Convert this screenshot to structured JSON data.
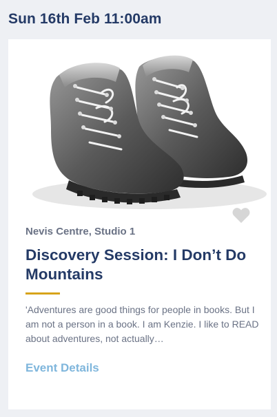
{
  "event": {
    "date": "Sun 16th Feb 11:00am",
    "image_alt": "Sketch of a pair of hiking boots",
    "favorite_icon": "heart-icon",
    "venue": "Nevis Centre, Studio 1",
    "title": "Discovery Session: I Don’t Do Mountains",
    "description": "'Adventures are good things for people in books. But I am not a person in a book. I am Kenzie. I like to READ about adventures, not actually…",
    "details_link": "Event Details"
  },
  "colors": {
    "page_background": "#eef0f4",
    "heading": "#243a66",
    "body_text": "#6a7285",
    "accent_rule": "#d7a31a",
    "link": "#7fb6dc",
    "favorite_icon": "#d6d6d6"
  }
}
